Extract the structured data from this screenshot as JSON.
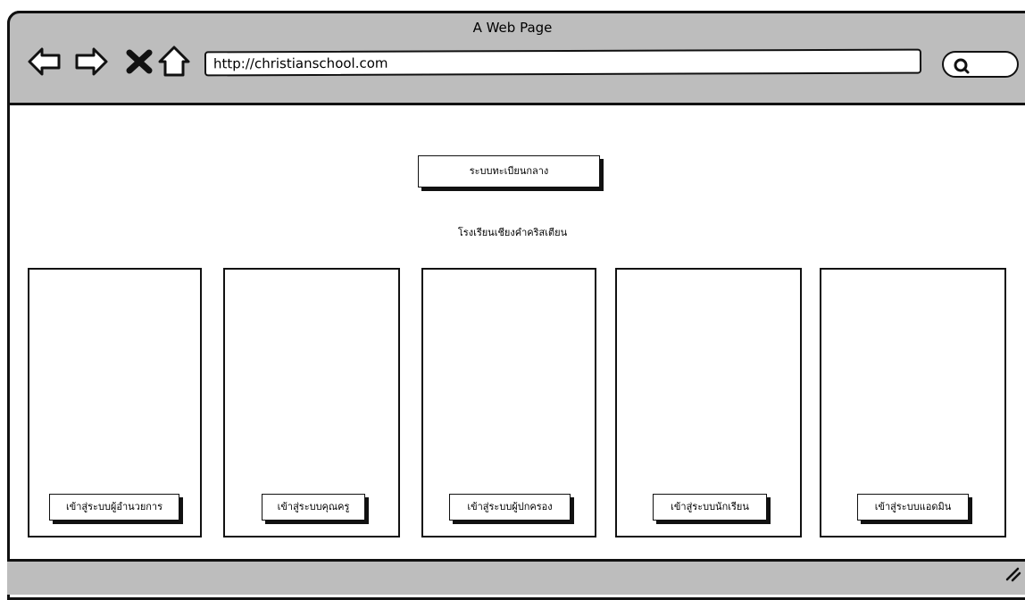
{
  "browser": {
    "title": "A Web Page",
    "url": "http://christianschool.com",
    "nav_icons": [
      "back-arrow-icon",
      "forward-arrow-icon",
      "close-x-icon",
      "home-icon"
    ],
    "search_icon": "search-icon"
  },
  "main": {
    "header_button": "ระบบทะเบียนกลาง",
    "subtitle": "โรงเรียนเชียงคำคริสเตียน",
    "cards": [
      {
        "button": "เข้าสู่ระบบผู้อำนวยการ"
      },
      {
        "button": "เข้าสู่ระบบคุณครู"
      },
      {
        "button": "เข้าสู่ระบบผู้ปกครอง"
      },
      {
        "button": "เข้าสู่ระบบนักเรียน"
      },
      {
        "button": "เข้าสู่ระบบแอดมิน"
      }
    ]
  }
}
